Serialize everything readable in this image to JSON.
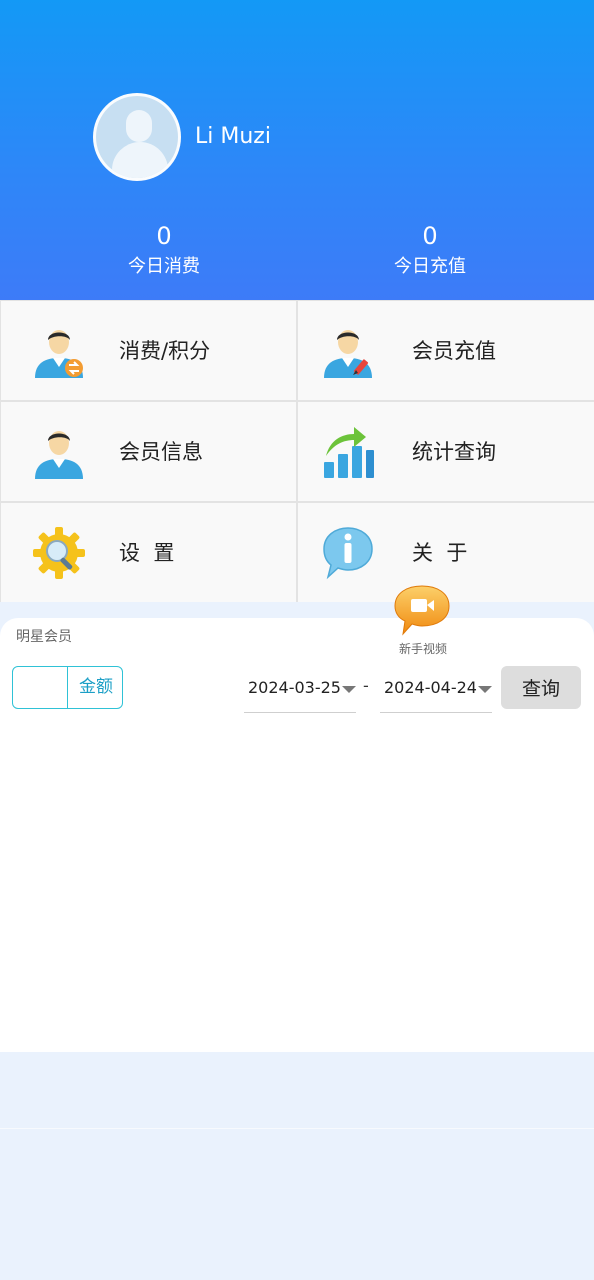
{
  "profile": {
    "username": "Li Muzi"
  },
  "stats": {
    "today_consume_value": "0",
    "today_consume_label": "今日消费",
    "today_recharge_value": "0",
    "today_recharge_label": "今日充值"
  },
  "menu": [
    {
      "label": "消费/积分",
      "icon": "member-exchange-icon"
    },
    {
      "label": "会员充值",
      "icon": "member-edit-icon"
    },
    {
      "label": "会员信息",
      "icon": "member-icon"
    },
    {
      "label": "统计查询",
      "icon": "bar-chart-icon"
    },
    {
      "label": "设  置",
      "icon": "gear-icon"
    },
    {
      "label": "关  于",
      "icon": "info-icon"
    }
  ],
  "video": {
    "label": "新手视频",
    "icon": "video-camera-icon"
  },
  "query": {
    "member_type": "明星会员",
    "amount_value": "",
    "amount_label": "金额",
    "start_date": "2024-03-25",
    "separator": "-",
    "end_date": "2024-04-24",
    "query_label": "查询"
  },
  "colors": {
    "header_top": "#1399F6",
    "header_bottom": "#3D7BF8",
    "accent": "#2FC2D6",
    "page_bg": "#EAF2FD"
  }
}
